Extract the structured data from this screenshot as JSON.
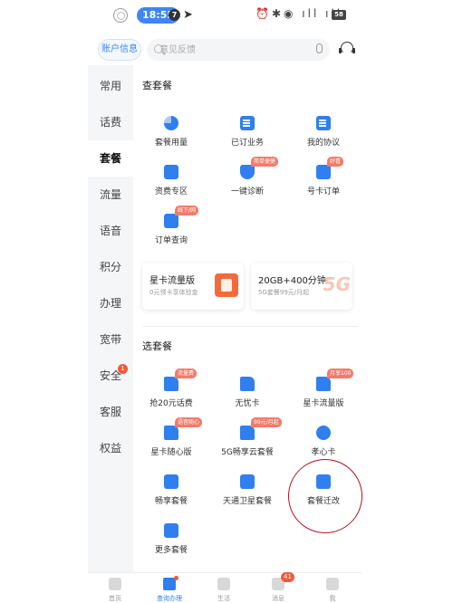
{
  "status": {
    "time": "18:55",
    "notif_count": "7",
    "battery": "58"
  },
  "topbar": {
    "account_label": "账户信息",
    "search_placeholder": "意见反馈"
  },
  "sidebar": {
    "items": [
      {
        "label": "常用"
      },
      {
        "label": "话费"
      },
      {
        "label": "套餐"
      },
      {
        "label": "流量"
      },
      {
        "label": "语音"
      },
      {
        "label": "积分"
      },
      {
        "label": "办理"
      },
      {
        "label": "宽带"
      },
      {
        "label": "安全",
        "badge": "1"
      },
      {
        "label": "客服"
      },
      {
        "label": "权益"
      }
    ]
  },
  "check_plan": {
    "title": "查套餐",
    "items": [
      {
        "label": "套餐用量",
        "tag": ""
      },
      {
        "label": "已订业务",
        "tag": ""
      },
      {
        "label": "我的协议",
        "tag": ""
      },
      {
        "label": "资费专区",
        "tag": ""
      },
      {
        "label": "一键诊断",
        "tag": "简单便捷"
      },
      {
        "label": "号卡订单",
        "tag": "好看"
      },
      {
        "label": "订单查询",
        "tag": "线下/网"
      }
    ],
    "promo_cards": [
      {
        "title": "星卡流量版",
        "subtitle": "0元领卡享体验金"
      },
      {
        "title": "20GB+400分钟",
        "subtitle": "5G套餐99元/月起",
        "art": "5G"
      }
    ]
  },
  "choose_plan": {
    "title": "选套餐",
    "items": [
      {
        "label": "抢20元话费",
        "tag": "流量费"
      },
      {
        "label": "无忧卡",
        "tag": ""
      },
      {
        "label": "星卡流量版",
        "tag": "月享100"
      },
      {
        "label": "星卡随心版",
        "tag": "语音随心"
      },
      {
        "label": "5G畅享云套餐",
        "tag": "99元/月起"
      },
      {
        "label": "孝心卡",
        "tag": ""
      },
      {
        "label": "畅享套餐",
        "tag": ""
      },
      {
        "label": "天通卫星套餐",
        "tag": ""
      },
      {
        "label": "套餐迁改",
        "tag": ""
      },
      {
        "label": "更多套餐",
        "tag": ""
      }
    ]
  },
  "bottom_nav": {
    "items": [
      {
        "label": "首页"
      },
      {
        "label": "查询办理",
        "active": true
      },
      {
        "label": "生活"
      },
      {
        "label": "消息",
        "count": "41"
      },
      {
        "label": "我"
      }
    ]
  },
  "colors": {
    "accent": "#2f7ff0",
    "tag": "#f47a6a",
    "annotation": "#b5121b"
  }
}
